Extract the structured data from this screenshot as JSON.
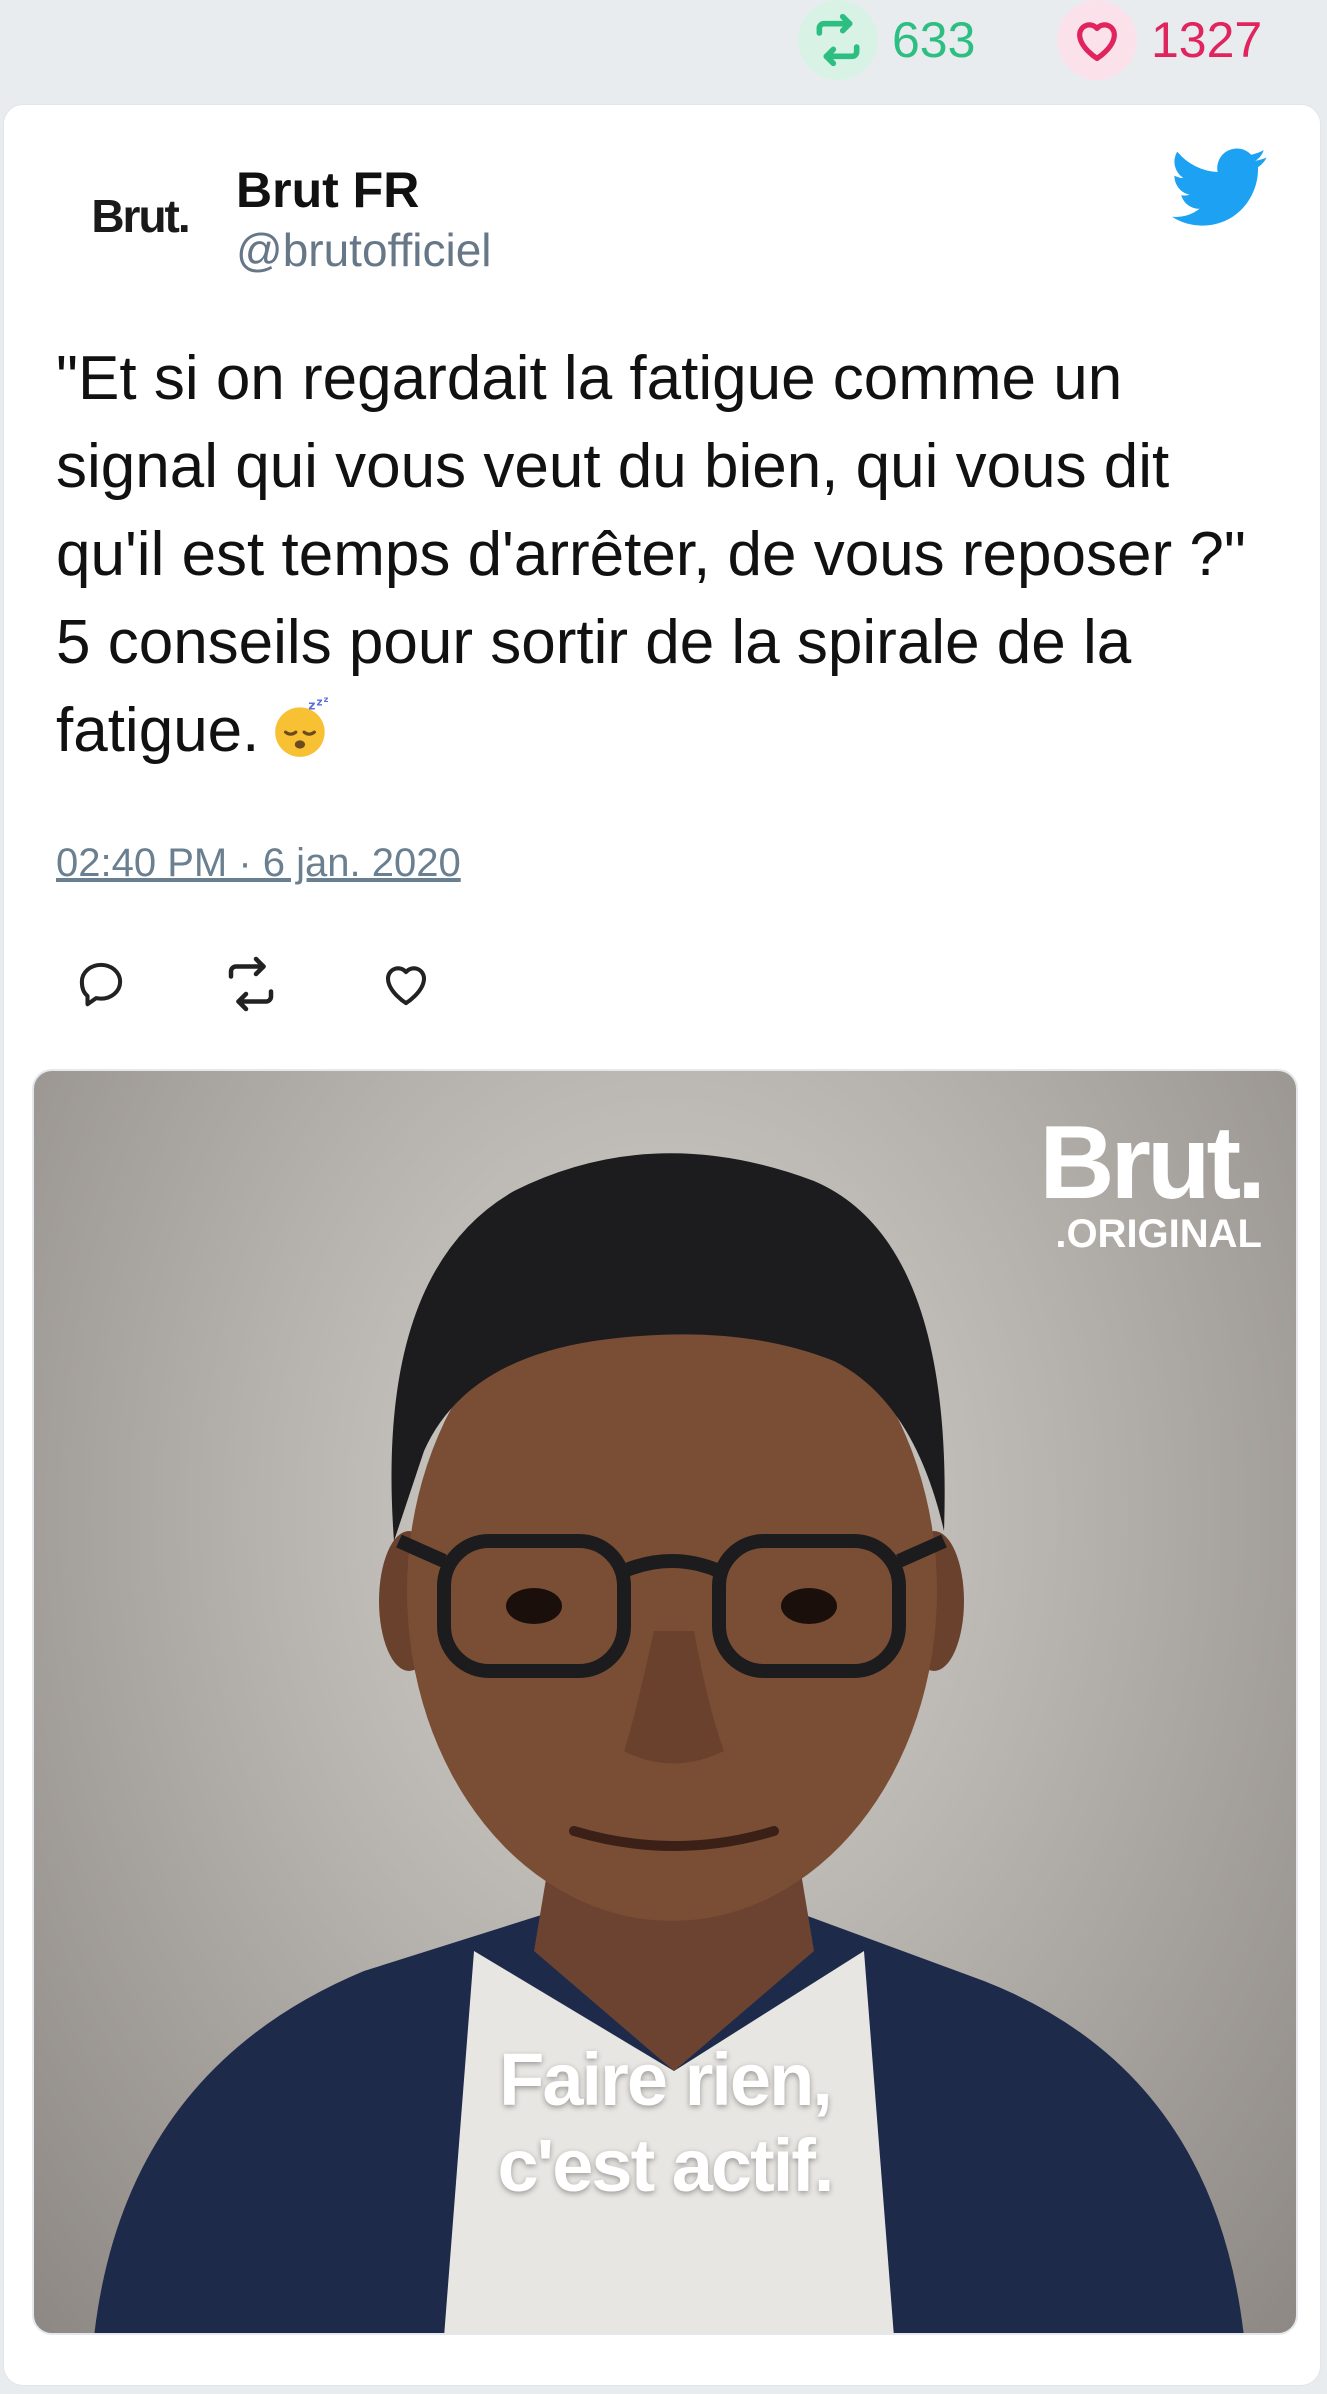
{
  "stats": {
    "retweet_icon": "retweet-icon",
    "retweet_count": "633",
    "like_icon": "heart-icon",
    "like_count": "1327"
  },
  "tweet": {
    "avatar_text": "Brut.",
    "author_name": "Brut FR",
    "author_handle": "@brutofficiel",
    "text": "\"Et si on regardait la fatigue comme un signal qui vous veut du bien, qui vous dit qu'il est temps d'arrêter, de vous reposer ?\" 5 conseils pour sortir de la spirale de la fatigue.",
    "emoji": "sleeping-face-emoji",
    "timestamp": "02:40 PM · 6 jan. 2020"
  },
  "media": {
    "brand_line1": "Brut.",
    "brand_line2": ".ORIGINAL",
    "caption_line1": "Faire rien,",
    "caption_line2": "c'est actif."
  },
  "colors": {
    "retweet": "#2dbe82",
    "like": "#e0245e",
    "twitter_blue": "#1da1f2"
  }
}
